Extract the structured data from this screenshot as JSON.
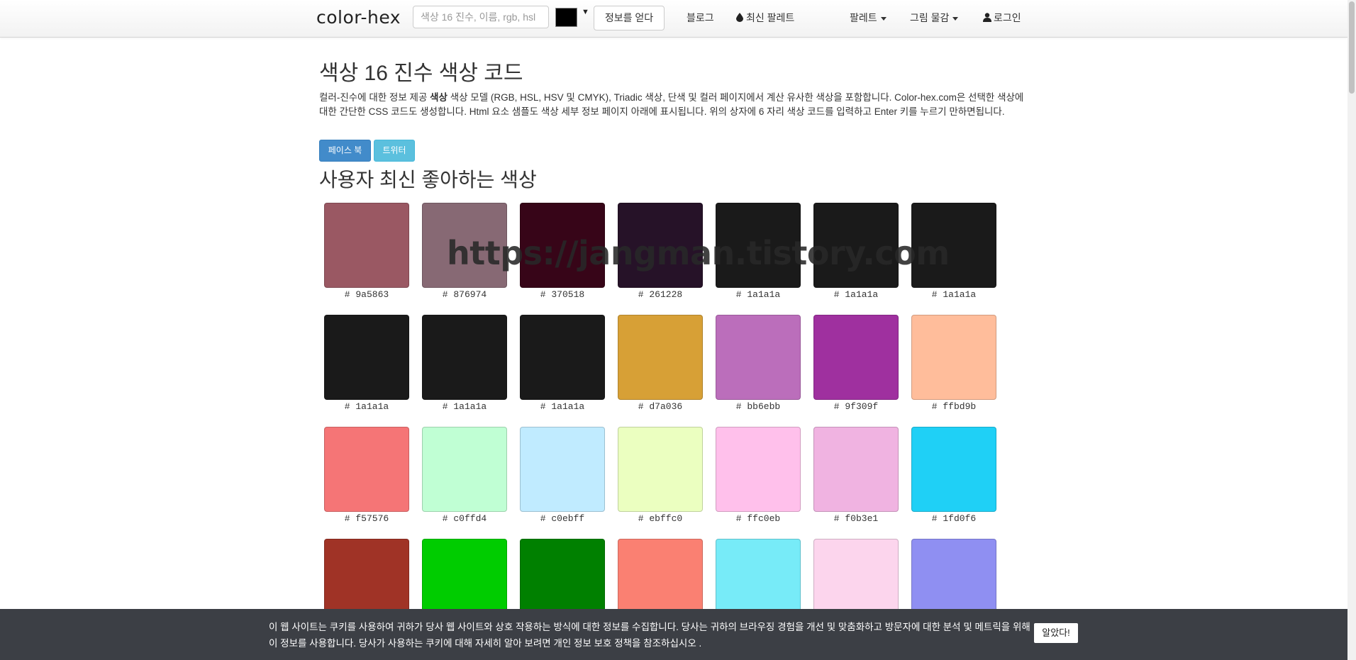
{
  "header": {
    "brand": "color-hex",
    "search_placeholder": "색상 16 진수, 이름, rgb, hsl",
    "picker_arrow": "▼",
    "get_info_label": "정보를 얻다",
    "blog_label": "블로그",
    "latest_palettes_label": "최신 팔레트",
    "palettes_label": "팔레트",
    "paint_label": "그림 물감",
    "login_label": "로그인",
    "picker_color": "#000000"
  },
  "main": {
    "title": "색상 16 진수 색상 코드",
    "intro_part1": "컬러-진수에 대한 정보 제공 ",
    "intro_bold": "색상",
    "intro_part2": " 색상 모델 (RGB, HSL, HSV 및 CMYK), Triadic 색상, 단색 및 컬러 페이지에서 계산 유사한 색상을 포함합니다. Color-hex.com은 선택한 색상에 대한 간단한 CSS 코드도 생성합니다. Html 요소 샘플도 색상 세부 정보 페이지 아래에 표시됩니다. 위의 상자에 6 자리 색상 코드를 입력하고 Enter 키를 누르기 만하면됩니다.",
    "facebook_label": "페이스 북",
    "twitter_label": "트위터",
    "section_title": "사용자 최신 좋아하는 색상"
  },
  "colors": [
    {
      "hex": "#9a5863",
      "label": "# 9a5863"
    },
    {
      "hex": "#876974",
      "label": "# 876974"
    },
    {
      "hex": "#370518",
      "label": "# 370518"
    },
    {
      "hex": "#261228",
      "label": "# 261228"
    },
    {
      "hex": "#1a1a1a",
      "label": "# 1a1a1a"
    },
    {
      "hex": "#1a1a1a",
      "label": "# 1a1a1a"
    },
    {
      "hex": "#1a1a1a",
      "label": "# 1a1a1a"
    },
    {
      "hex": "#1a1a1a",
      "label": "# 1a1a1a"
    },
    {
      "hex": "#1a1a1a",
      "label": "# 1a1a1a"
    },
    {
      "hex": "#1a1a1a",
      "label": "# 1a1a1a"
    },
    {
      "hex": "#d7a036",
      "label": "# d7a036"
    },
    {
      "hex": "#bb6ebb",
      "label": "# bb6ebb"
    },
    {
      "hex": "#9f309f",
      "label": "# 9f309f"
    },
    {
      "hex": "#ffbd9b",
      "label": "# ffbd9b"
    },
    {
      "hex": "#f57576",
      "label": "# f57576"
    },
    {
      "hex": "#c0ffd4",
      "label": "# c0ffd4"
    },
    {
      "hex": "#c0ebff",
      "label": "# c0ebff"
    },
    {
      "hex": "#ebffc0",
      "label": "# ebffc0"
    },
    {
      "hex": "#ffc0eb",
      "label": "# ffc0eb"
    },
    {
      "hex": "#f0b3e1",
      "label": "# f0b3e1"
    },
    {
      "hex": "#1fd0f6",
      "label": "# 1fd0f6"
    },
    {
      "hex": "#a03326",
      "label": ""
    },
    {
      "hex": "#00cc00",
      "label": ""
    },
    {
      "hex": "#008000",
      "label": ""
    },
    {
      "hex": "#fa8072",
      "label": ""
    },
    {
      "hex": "#77ebf8",
      "label": ""
    },
    {
      "hex": "#fcd5ed",
      "label": ""
    },
    {
      "hex": "#8f8ff2",
      "label": ""
    }
  ],
  "watermark": "https://jangman.tistory.com",
  "cookie": {
    "text": "이 웹 사이트는 쿠키를 사용하여 귀하가 당사 웹 사이트와 상호 작용하는 방식에 대한 정보를 수집합니다. 당사는 귀하의 브라우징 경험을 개선 및 맞춤화하고 방문자에 대한 분석 및 메트릭을 위해이 정보를 사용합니다. 당사가 사용하는 쿠키에 대해 자세히 알아 보려면 개인 정보 보호 정책을 참조하십시오 .",
    "accept_label": "알았다!"
  }
}
